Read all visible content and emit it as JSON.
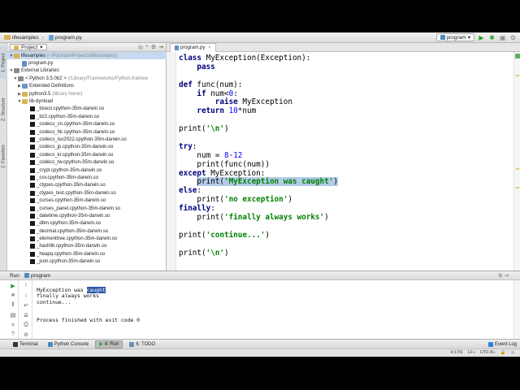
{
  "navbar": {
    "crumbs": [
      "lifesamples",
      "program.py"
    ],
    "run_config": "program"
  },
  "side_tabs": {
    "project": "1: Project",
    "structure": "Z: Structure",
    "favorites": "2: Favorites"
  },
  "project_panel": {
    "dropdown_label": "Project",
    "tree": [
      {
        "label": "lifesamples",
        "muted": "(~/PycharmProjects/lifesamples)",
        "icon": "folder",
        "twisty": "▼",
        "indent": 0,
        "selected": true
      },
      {
        "label": "program.py",
        "muted": "",
        "icon": "pyfile",
        "twisty": "",
        "indent": 2,
        "selected": false
      },
      {
        "label": "External Libraries",
        "muted": "",
        "icon": "lib",
        "twisty": "▼",
        "indent": 0,
        "selected": false
      },
      {
        "label": "< Python 3.5.0b2 >",
        "muted": "(/Library/Frameworks/Python.framew",
        "icon": "lib",
        "twisty": "▼",
        "indent": 1,
        "selected": false
      },
      {
        "label": "Extended Definitions",
        "muted": "",
        "icon": "bluefolder",
        "twisty": "▶",
        "indent": 2,
        "selected": false
      },
      {
        "label": "python3.5",
        "muted": "(library home)",
        "icon": "folder",
        "twisty": "▶",
        "indent": 2,
        "selected": false
      },
      {
        "label": "lib-dynload",
        "muted": "",
        "icon": "folder",
        "twisty": "▼",
        "indent": 2,
        "selected": false
      },
      {
        "label": "_bisect.cpython-35m-darwin.so",
        "muted": "",
        "icon": "so",
        "twisty": "",
        "indent": 4,
        "selected": false
      },
      {
        "label": "_bz2.cpython-35m-darwin.so",
        "muted": "",
        "icon": "so",
        "twisty": "",
        "indent": 4,
        "selected": false
      },
      {
        "label": "_codecs_cn.cpython-35m-darwin.so",
        "muted": "",
        "icon": "so",
        "twisty": "",
        "indent": 4,
        "selected": false
      },
      {
        "label": "_codecs_hk.cpython-35m-darwin.so",
        "muted": "",
        "icon": "so",
        "twisty": "",
        "indent": 4,
        "selected": false
      },
      {
        "label": "_codecs_iso2022.cpython-35m-darwin.so",
        "muted": "",
        "icon": "so",
        "twisty": "",
        "indent": 4,
        "selected": false
      },
      {
        "label": "_codecs_jp.cpython-35m-darwin.so",
        "muted": "",
        "icon": "so",
        "twisty": "",
        "indent": 4,
        "selected": false
      },
      {
        "label": "_codecs_kr.cpython-35m-darwin.so",
        "muted": "",
        "icon": "so",
        "twisty": "",
        "indent": 4,
        "selected": false
      },
      {
        "label": "_codecs_tw.cpython-35m-darwin.so",
        "muted": "",
        "icon": "so",
        "twisty": "",
        "indent": 4,
        "selected": false
      },
      {
        "label": "_crypt.cpython-35m-darwin.so",
        "muted": "",
        "icon": "so",
        "twisty": "",
        "indent": 4,
        "selected": false
      },
      {
        "label": "_csv.cpython-35m-darwin.so",
        "muted": "",
        "icon": "so",
        "twisty": "",
        "indent": 4,
        "selected": false
      },
      {
        "label": "_ctypes.cpython-35m-darwin.so",
        "muted": "",
        "icon": "so",
        "twisty": "",
        "indent": 4,
        "selected": false
      },
      {
        "label": "_ctypes_test.cpython-35m-darwin.so",
        "muted": "",
        "icon": "so",
        "twisty": "",
        "indent": 4,
        "selected": false
      },
      {
        "label": "_curses.cpython-35m-darwin.so",
        "muted": "",
        "icon": "so",
        "twisty": "",
        "indent": 4,
        "selected": false
      },
      {
        "label": "_curses_panel.cpython-35m-darwin.so",
        "muted": "",
        "icon": "so",
        "twisty": "",
        "indent": 4,
        "selected": false
      },
      {
        "label": "_datetime.cpython-35m-darwin.so",
        "muted": "",
        "icon": "so",
        "twisty": "",
        "indent": 4,
        "selected": false
      },
      {
        "label": "_dbm.cpython-35m-darwin.so",
        "muted": "",
        "icon": "so",
        "twisty": "",
        "indent": 4,
        "selected": false
      },
      {
        "label": "_decimal.cpython-35m-darwin.so",
        "muted": "",
        "icon": "so",
        "twisty": "",
        "indent": 4,
        "selected": false
      },
      {
        "label": "_elementtree.cpython-35m-darwin.so",
        "muted": "",
        "icon": "so",
        "twisty": "",
        "indent": 4,
        "selected": false
      },
      {
        "label": "_hashlib.cpython-35m-darwin.so",
        "muted": "",
        "icon": "so",
        "twisty": "",
        "indent": 4,
        "selected": false
      },
      {
        "label": "_heapq.cpython-35m-darwin.so",
        "muted": "",
        "icon": "so",
        "twisty": "",
        "indent": 4,
        "selected": false
      },
      {
        "label": "_json.cpython-35m-darwin.so",
        "muted": "",
        "icon": "so",
        "twisty": "",
        "indent": 4,
        "selected": false
      }
    ]
  },
  "editor": {
    "tab_label": "program.py",
    "lines": [
      [
        {
          "t": "class ",
          "c": "kw"
        },
        {
          "t": "MyException(Exception):",
          "c": ""
        }
      ],
      [
        {
          "t": "    ",
          "c": ""
        },
        {
          "t": "pass",
          "c": "kw"
        }
      ],
      [],
      [
        {
          "t": "def ",
          "c": "kw"
        },
        {
          "t": "func(num):",
          "c": ""
        }
      ],
      [
        {
          "t": "    ",
          "c": ""
        },
        {
          "t": "if ",
          "c": "kw"
        },
        {
          "t": "num<",
          "c": ""
        },
        {
          "t": "0",
          "c": "num"
        },
        {
          "t": ":",
          "c": ""
        }
      ],
      [
        {
          "t": "        ",
          "c": ""
        },
        {
          "t": "raise ",
          "c": "kw"
        },
        {
          "t": "MyException",
          "c": ""
        }
      ],
      [
        {
          "t": "    ",
          "c": ""
        },
        {
          "t": "return ",
          "c": "kw"
        },
        {
          "t": "10",
          "c": "num"
        },
        {
          "t": "*num",
          "c": ""
        }
      ],
      [],
      [
        {
          "t": "print(",
          "c": ""
        },
        {
          "t": "'\\n'",
          "c": "str"
        },
        {
          "t": ")",
          "c": ""
        }
      ],
      [],
      [
        {
          "t": "try",
          "c": "kw"
        },
        {
          "t": ":",
          "c": ""
        }
      ],
      [
        {
          "t": "    num = ",
          "c": ""
        },
        {
          "t": "8",
          "c": "num"
        },
        {
          "t": "-",
          "c": ""
        },
        {
          "t": "12",
          "c": "num"
        }
      ],
      [
        {
          "t": "    print(func(num))",
          "c": ""
        }
      ],
      [
        {
          "t": "except ",
          "c": "kw"
        },
        {
          "t": "MyException:",
          "c": ""
        }
      ],
      [
        {
          "t": "    ",
          "c": ""
        },
        {
          "t": "print(",
          "c": "hl"
        },
        {
          "t": "'MyException was caught'",
          "c": "str hl"
        },
        {
          "t": ")",
          "c": "hl"
        }
      ],
      [
        {
          "t": "else",
          "c": "kw"
        },
        {
          "t": ":",
          "c": ""
        }
      ],
      [
        {
          "t": "    print(",
          "c": ""
        },
        {
          "t": "'no exception'",
          "c": "str"
        },
        {
          "t": ")",
          "c": ""
        }
      ],
      [
        {
          "t": "finally",
          "c": "kw"
        },
        {
          "t": ":",
          "c": ""
        }
      ],
      [
        {
          "t": "    print(",
          "c": ""
        },
        {
          "t": "'finally always works'",
          "c": "str"
        },
        {
          "t": ")",
          "c": ""
        }
      ],
      [],
      [
        {
          "t": "print(",
          "c": ""
        },
        {
          "t": "'continue...'",
          "c": "str"
        },
        {
          "t": ")",
          "c": ""
        }
      ],
      [],
      [
        {
          "t": "print(",
          "c": ""
        },
        {
          "t": "'\\n'",
          "c": "str"
        },
        {
          "t": ")",
          "c": ""
        }
      ]
    ]
  },
  "run_panel": {
    "tab_label": "Run",
    "program_label": "program",
    "output": {
      "line1_prefix": "MyException wa",
      "line1_mid": "s ",
      "line1_selected": "caught",
      "line2": "finally always works",
      "line3": "continue...",
      "exit": "Process finished with exit code 0"
    }
  },
  "bottom_tools": {
    "terminal": "Terminal",
    "python_console": "Python Console",
    "run": "4: Run",
    "todo": "6: TODO",
    "event_log": "Event Log"
  },
  "status": {
    "position": "4:17/6",
    "line_sep": "LF÷",
    "encoding": "UTF-8÷"
  }
}
